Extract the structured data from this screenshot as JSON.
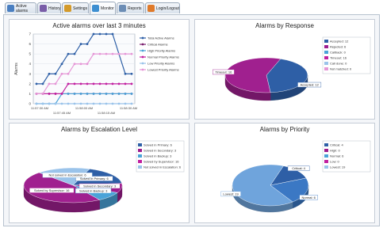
{
  "tabs": [
    {
      "label": "Active alarms",
      "icon": "alarm-bell-icon",
      "color": "#4a7fc1"
    },
    {
      "label": "History",
      "icon": "history-icon",
      "color": "#7a5da8"
    },
    {
      "label": "Settings",
      "icon": "settings-icon",
      "color": "#d49a2a"
    },
    {
      "label": "Monitor",
      "icon": "monitor-icon",
      "color": "#3d8fd1"
    },
    {
      "label": "Reports",
      "icon": "reports-icon",
      "color": "#6c8db5"
    },
    {
      "label": "Login/Logout",
      "icon": "login-icon",
      "color": "#e07a2a"
    }
  ],
  "active_tab": "Monitor",
  "chart_data": [
    {
      "type": "line",
      "title": "Active alarms over last 3 minutes",
      "ylabel": "Alarms",
      "ylim": [
        0,
        7
      ],
      "yticks": [
        0,
        1,
        2,
        3,
        4,
        5,
        6,
        7
      ],
      "x_ticks_row1": [
        "11:57:30 AM",
        "11:58:00 AM",
        "11:58:30 AM"
      ],
      "x_ticks_row2": [
        "11:57:45 AM",
        "11:58:15 AM"
      ],
      "series": [
        {
          "name": "Total Active Alarms",
          "color": "#2e5fa6",
          "values": [
            2,
            2,
            3,
            3,
            4,
            5,
            5,
            6,
            6,
            7,
            7,
            7,
            7,
            5,
            3,
            3
          ]
        },
        {
          "name": "Critical Alarms",
          "color": "#7a1f6e",
          "values": [
            1,
            1,
            1,
            1,
            1,
            1,
            1,
            1,
            1,
            1,
            1,
            1,
            1,
            1,
            1,
            1
          ]
        },
        {
          "name": "High Priority Alarms",
          "color": "#4aa3d8",
          "values": [
            0,
            0,
            0,
            0,
            1,
            1,
            1,
            1,
            1,
            1,
            1,
            1,
            1,
            1,
            1,
            1
          ]
        },
        {
          "name": "Normal Priority Alarms",
          "color": "#c11fa0",
          "values": [
            1,
            1,
            1,
            1,
            1,
            2,
            2,
            2,
            2,
            2,
            2,
            2,
            2,
            2,
            2,
            2
          ]
        },
        {
          "name": "Low Priority Alarms",
          "color": "#9ac3ea",
          "values": [
            0,
            0,
            0,
            0,
            0,
            0,
            0,
            0,
            0,
            0,
            0,
            0,
            0,
            0,
            0,
            0
          ]
        },
        {
          "name": "Lowest Priority Alarms",
          "color": "#e596d6",
          "values": [
            1,
            1,
            2,
            2,
            3,
            3,
            4,
            4,
            4,
            5,
            5,
            5,
            5,
            5,
            5,
            5
          ]
        }
      ]
    },
    {
      "type": "pie",
      "title": "Alarms by Response",
      "legend": [
        {
          "label": "Accepted: 12",
          "color": "#2e5fa6"
        },
        {
          "label": "Rejected: 6",
          "color": "#9e1c8e"
        },
        {
          "label": "Callback: 0",
          "color": "#4aa3d8"
        },
        {
          "label": "Timeout: 16",
          "color": "#c11fa0"
        },
        {
          "label": "Call done: 0",
          "color": "#9ac3ea"
        },
        {
          "label": "Not matched: 0",
          "color": "#e596d6"
        }
      ],
      "slices": [
        {
          "label": "Accepted: 12",
          "value": 12,
          "color": "#2e5fa6",
          "pos": "top-right"
        },
        {
          "label": "Timeout: 16",
          "value": 16,
          "color": "#a0208f",
          "pos": "bottom-left"
        }
      ]
    },
    {
      "type": "pie",
      "title": "Alarms by Escalation Level",
      "legend": [
        {
          "label": "Solved in Primary: 6",
          "color": "#2e5fa6"
        },
        {
          "label": "Solved in Secondary: 3",
          "color": "#9e1c8e"
        },
        {
          "label": "Solved in Backup: 3",
          "color": "#4aa3d8"
        },
        {
          "label": "Solved by Supervisor: 16",
          "color": "#c11fa0"
        },
        {
          "label": "Not solved in Escalation: 6",
          "color": "#9ac3ea"
        }
      ],
      "slices": [
        {
          "label": "Solved in Primary: 6",
          "value": 6,
          "color": "#2e5fa6"
        },
        {
          "label": "Solved in Secondary: 3",
          "value": 3,
          "color": "#9e1c8e"
        },
        {
          "label": "Solved in Backup: 3",
          "value": 3,
          "color": "#4aa3d8"
        },
        {
          "label": "Solved by Supervisor: 16",
          "value": 16,
          "color": "#a0208f"
        },
        {
          "label": "Not solved in Escalation: 6",
          "value": 6,
          "color": "#9ac3ea"
        }
      ]
    },
    {
      "type": "pie",
      "title": "Alarms by Priority",
      "legend": [
        {
          "label": "Critical: 4",
          "color": "#2e5fa6"
        },
        {
          "label": "High: 0",
          "color": "#9e1c8e"
        },
        {
          "label": "Normal: 6",
          "color": "#4aa3d8"
        },
        {
          "label": "Low: 0",
          "color": "#c11fa0"
        },
        {
          "label": "Lowest: 19",
          "color": "#9ac3ea"
        }
      ],
      "slices": [
        {
          "label": "Critical: 4",
          "value": 4,
          "color": "#2e5fa6"
        },
        {
          "label": "Normal: 6",
          "value": 6,
          "color": "#3b78c4"
        },
        {
          "label": "Lowest: 19",
          "value": 19,
          "color": "#6fa4dc"
        }
      ]
    }
  ]
}
